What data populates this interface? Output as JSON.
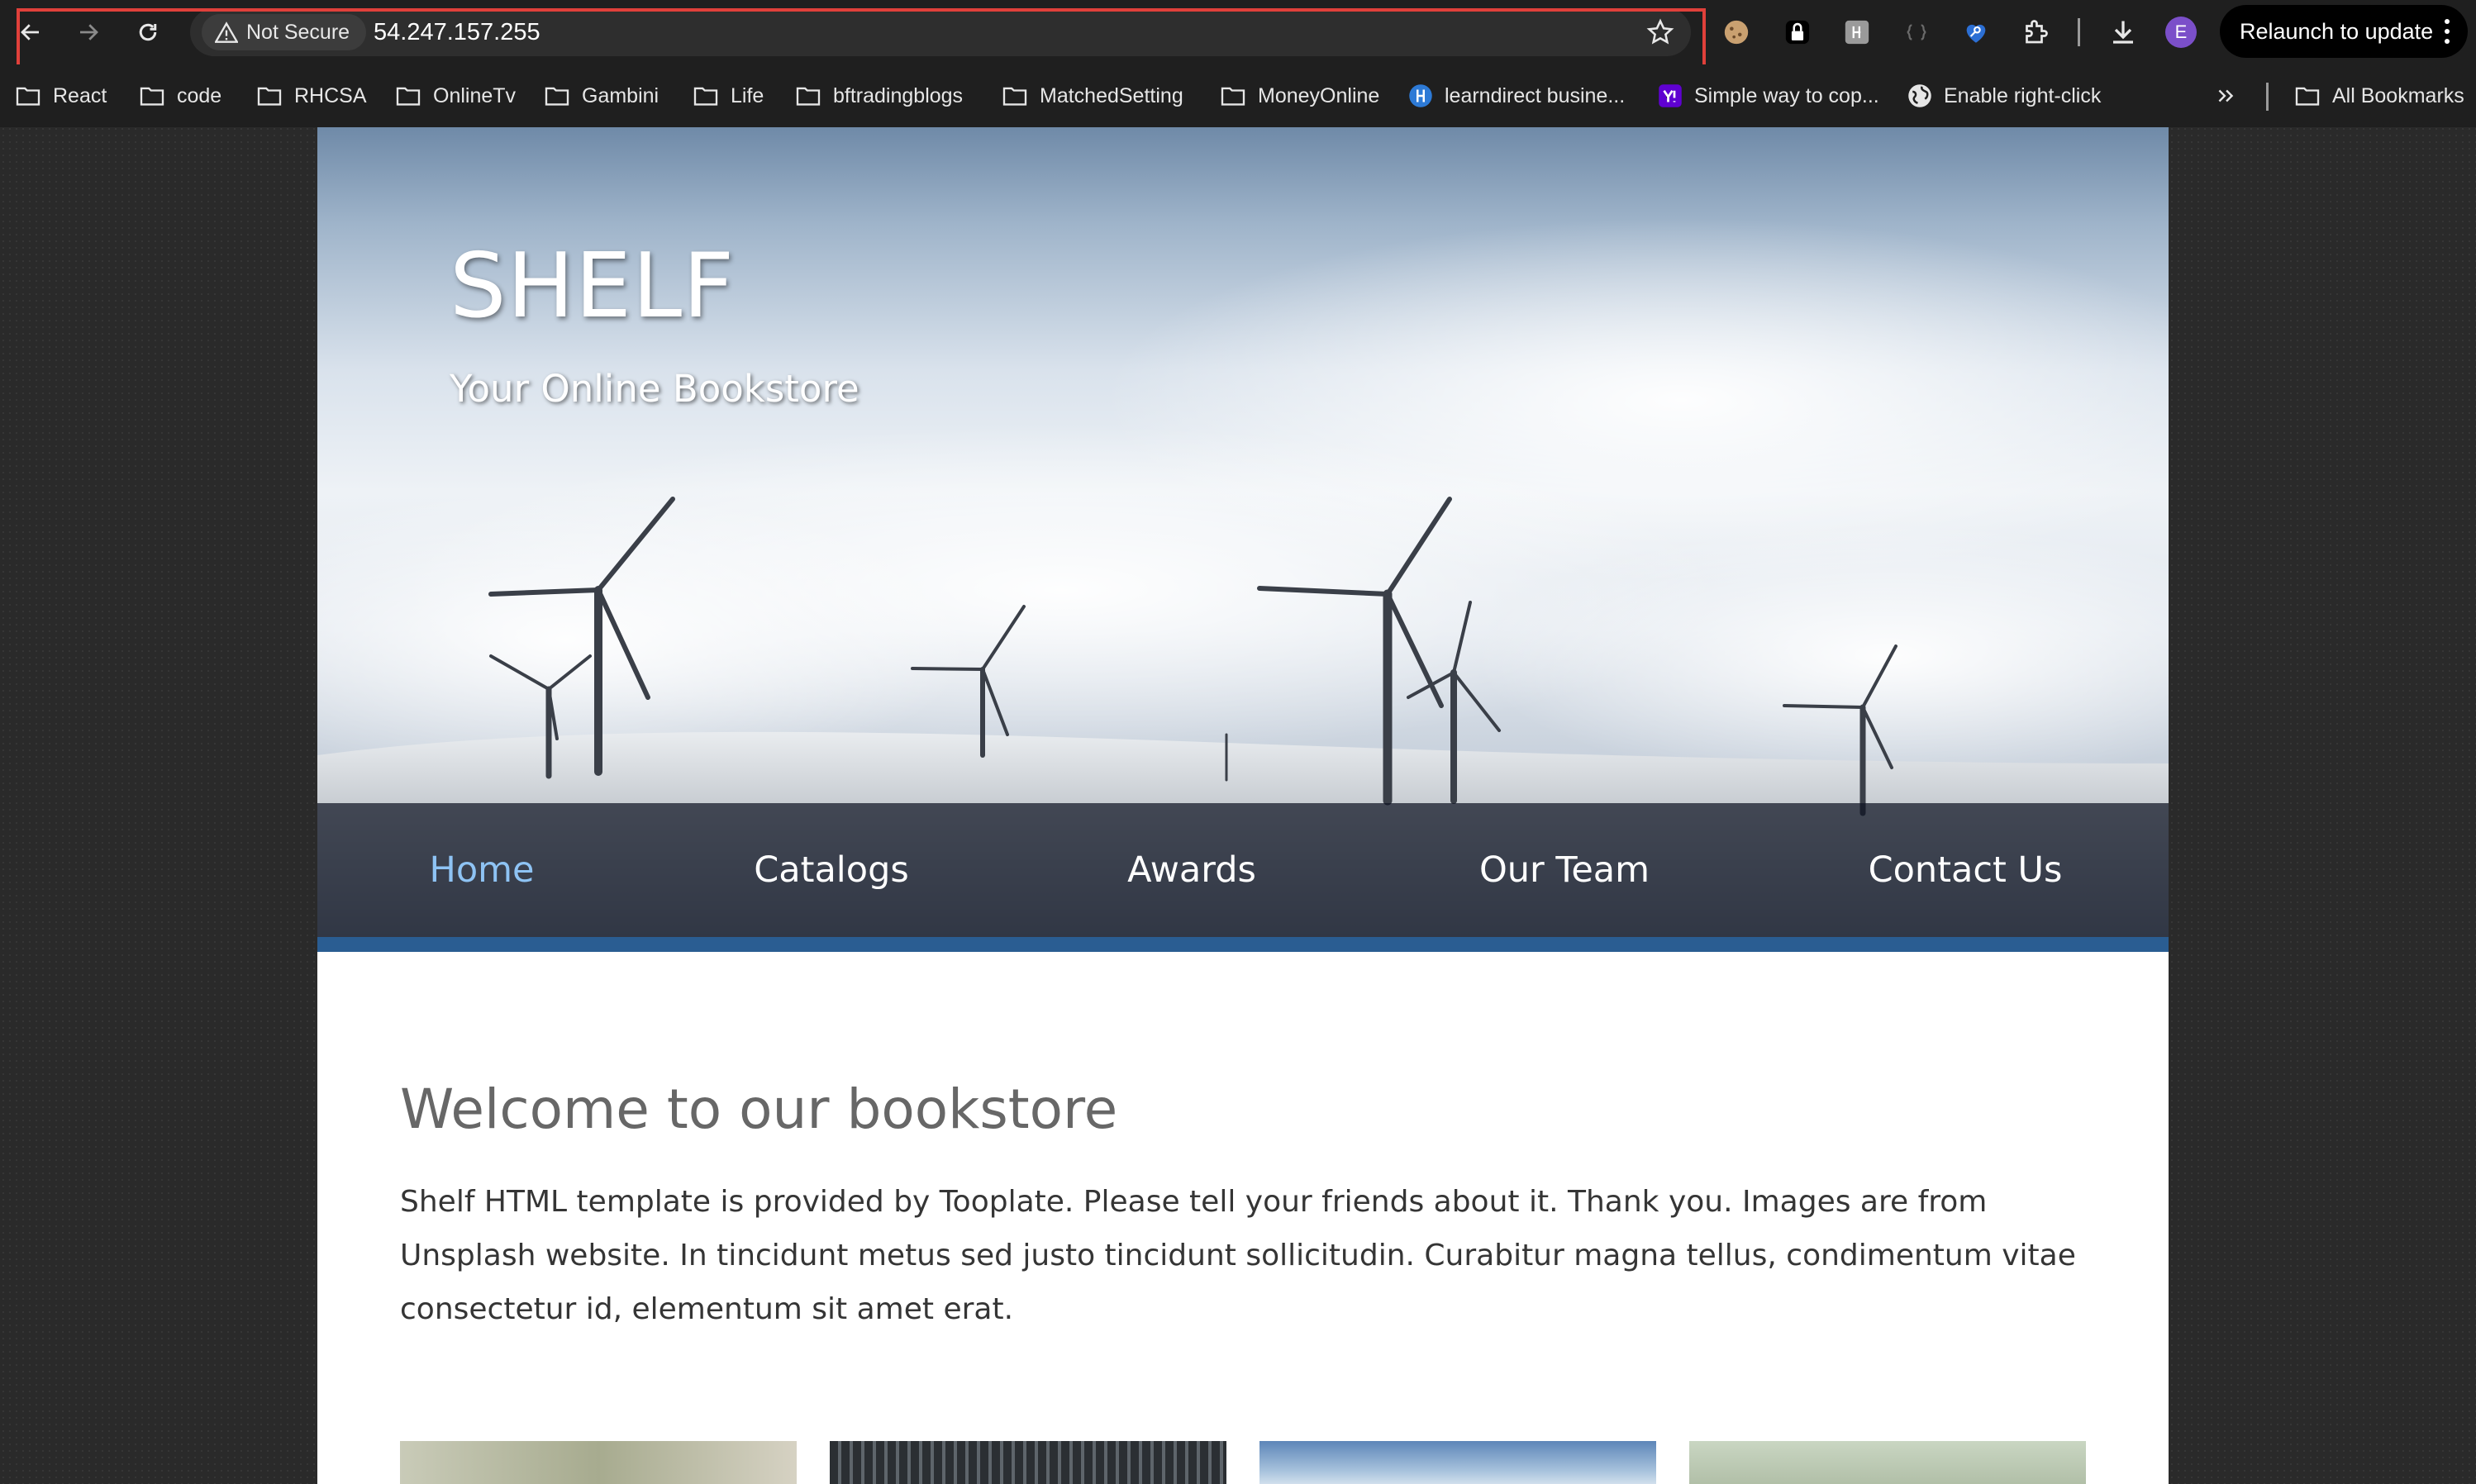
{
  "browser": {
    "security_label": "Not Secure",
    "url": "54.247.157.255",
    "relaunch_label": "Relaunch to update",
    "profile_initial": "E"
  },
  "bookmarks": [
    {
      "label": "React",
      "icon": "folder-icon"
    },
    {
      "label": "code",
      "icon": "folder-icon"
    },
    {
      "label": "RHCSA",
      "icon": "folder-icon"
    },
    {
      "label": "OnlineTv",
      "icon": "folder-icon"
    },
    {
      "label": "Gambini",
      "icon": "folder-icon"
    },
    {
      "label": "Life",
      "icon": "folder-icon"
    },
    {
      "label": "bftradingblogs",
      "icon": "folder-icon"
    },
    {
      "label": "MatchedSetting",
      "icon": "folder-icon"
    },
    {
      "label": "MoneyOnline",
      "icon": "folder-icon"
    },
    {
      "label": "learndirect busine...",
      "icon": "learndirect-icon"
    },
    {
      "label": "Simple way to cop...",
      "icon": "yahoo-icon"
    },
    {
      "label": "Enable right-click",
      "icon": "globe-icon"
    }
  ],
  "all_bookmarks_label": "All Bookmarks",
  "site": {
    "brand": "SHELF",
    "tagline": "Your Online Bookstore",
    "nav": [
      {
        "label": "Home",
        "active": true
      },
      {
        "label": "Catalogs",
        "active": false
      },
      {
        "label": "Awards",
        "active": false
      },
      {
        "label": "Our Team",
        "active": false
      },
      {
        "label": "Contact Us",
        "active": false
      }
    ],
    "welcome_title": "Welcome to our bookstore",
    "welcome_body": "Shelf HTML template is provided by Tooplate. Please tell your friends about it. Thank you. Images are from Unsplash website. In tincidunt metus sed justo tincidunt sollicitudin. Curabitur magna tellus, condimentum vitae consectetur id, elementum sit amet erat."
  },
  "colors": {
    "accent": "#2a5d92",
    "nav_active": "#8ec3f4",
    "url_highlight": "#e0403a"
  }
}
